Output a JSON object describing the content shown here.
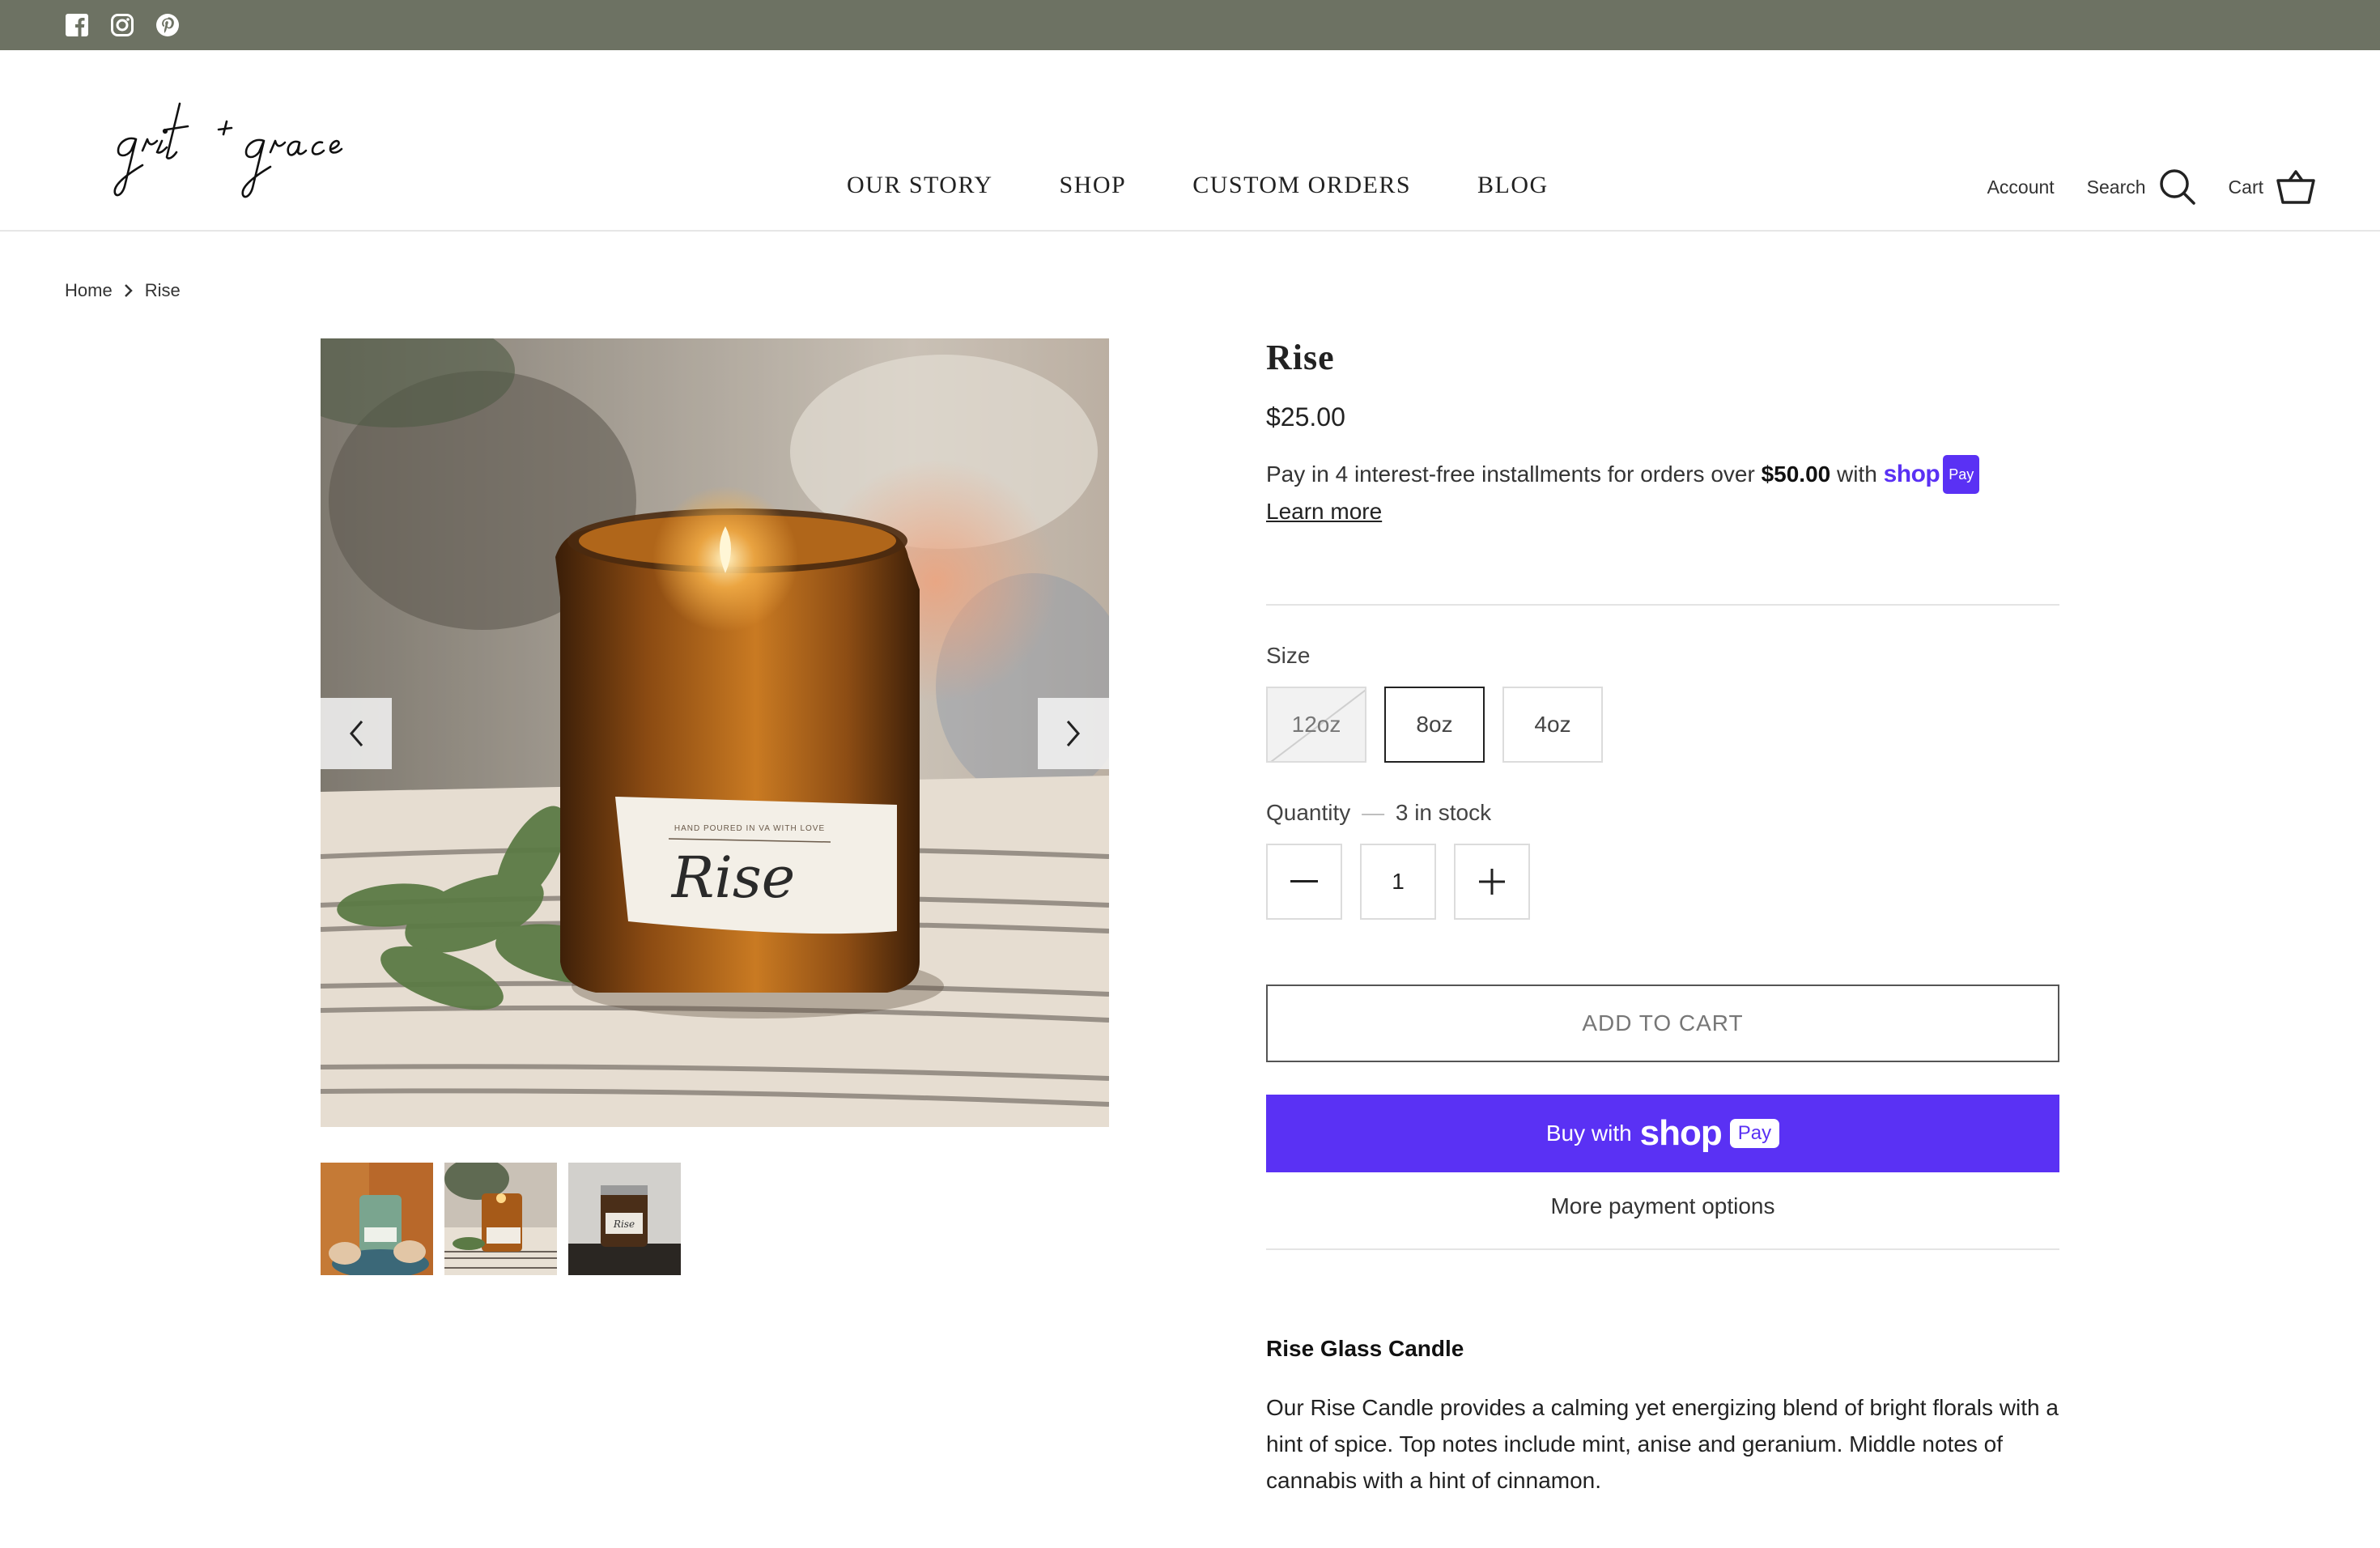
{
  "social": {
    "icons": [
      "facebook-icon",
      "instagram-icon",
      "pinterest-icon"
    ]
  },
  "header": {
    "logo_text": "grit + grace",
    "nav": [
      "OUR STORY",
      "SHOP",
      "CUSTOM ORDERS",
      "BLOG"
    ],
    "account": "Account",
    "search": "Search",
    "cart": "Cart"
  },
  "breadcrumb": {
    "home": "Home",
    "current": "Rise"
  },
  "product": {
    "title": "Rise",
    "price": "$25.00",
    "installments_text": "Pay in 4 interest-free installments for orders over",
    "installments_amount": "$50.00",
    "installments_with": "with",
    "shop_word": "shop",
    "pay_word": "Pay",
    "learn_more": "Learn more",
    "size_label": "Size",
    "sizes": [
      "12oz",
      "8oz",
      "4oz"
    ],
    "selected_size": "8oz",
    "quantity_label": "Quantity",
    "quantity_dash": "—",
    "stock": "3 in stock",
    "quantity": "1",
    "add_to_cart": "ADD TO CART",
    "buy_with": "Buy with",
    "more_payment": "More payment options",
    "desc_title": "Rise Glass Candle",
    "desc_body": "Our Rise Candle provides a calming yet energizing blend of bright florals with a hint of spice. Top notes include mint, anise and geranium. Middle notes of cannabis with a hint of cinnamon."
  },
  "image_label": {
    "small_text": "HAND POURED IN VA WITH LOVE",
    "script": "Rise"
  },
  "colors": {
    "topbar": "#6d7263",
    "shop_pay": "#5a31f4"
  }
}
